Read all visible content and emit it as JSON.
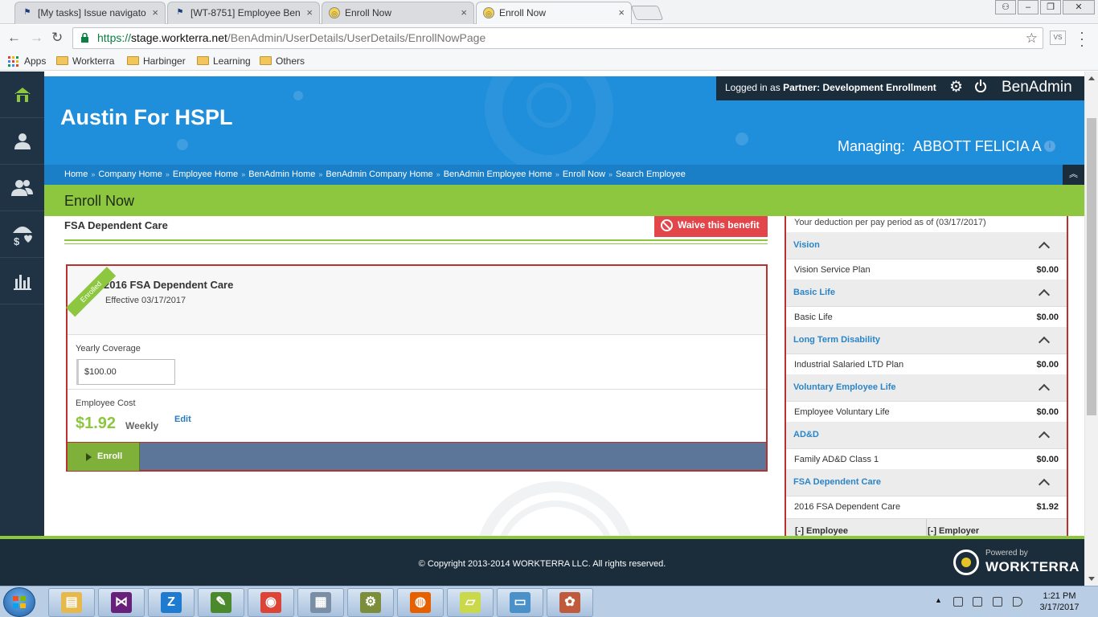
{
  "browser": {
    "tabs": [
      {
        "label": "[My tasks] Issue navigato",
        "active": false
      },
      {
        "label": "[WT-8751] Employee Ben",
        "active": false
      },
      {
        "label": "Enroll Now",
        "active": false
      },
      {
        "label": "Enroll Now",
        "active": true
      }
    ],
    "tab_close": "×",
    "url_scheme": "https://",
    "url_host": "stage.workterra.net",
    "url_path": "/BenAdmin/UserDetails/UserDetails/EnrollNowPage",
    "star": "☆",
    "ext_label": "VS",
    "back": "←",
    "forward": "→",
    "reload": "↻",
    "bookmarks": [
      {
        "label": "Apps",
        "icon": "apps-grid-icon"
      },
      {
        "label": "Workterra",
        "icon": "folder-icon"
      },
      {
        "label": "Harbinger",
        "icon": "folder-icon"
      },
      {
        "label": "Learning",
        "icon": "folder-icon"
      },
      {
        "label": "Others",
        "icon": "folder-icon"
      }
    ]
  },
  "header": {
    "logged_in_prefix": "Logged in as",
    "logged_in_role": "Partner:",
    "logged_in_name": "Development Enrollment",
    "brand": "BenAdmin",
    "company": "Austin For HSPL",
    "managing_label": "Managing:",
    "managing_name": "ABBOTT FELICIA A",
    "info_glyph": "i"
  },
  "breadcrumbs": [
    "Home",
    "Company Home",
    "Employee Home",
    "BenAdmin Home",
    "BenAdmin Company Home",
    "BenAdmin Employee Home",
    "Enroll Now",
    "Search Employee"
  ],
  "breadcrumb_sep": "»",
  "collapse_glyph": "︽",
  "page_title": "Enroll Now",
  "section": {
    "title": "FSA Dependent Care",
    "waive_label": "Waive this benefit"
  },
  "card": {
    "ribbon": "Enrolled",
    "plan_name": "2016 FSA Dependent Care",
    "effective": "Effective 03/17/2017",
    "coverage_label": "Yearly Coverage",
    "coverage_value": "$100.00",
    "cost_label": "Employee Cost",
    "cost_value": "$1.92",
    "cost_frequency": "Weekly",
    "edit_label": "Edit",
    "enroll_label": "Enroll"
  },
  "summary": {
    "as_of": "Your deduction per pay period as of (03/17/2017)",
    "groups": [
      {
        "name": "Vision",
        "item": "Vision Service Plan",
        "amount": "$0.00"
      },
      {
        "name": "Basic Life",
        "item": "Basic Life",
        "amount": "$0.00"
      },
      {
        "name": "Long Term Disability",
        "item": "Industrial Salaried LTD Plan",
        "amount": "$0.00"
      },
      {
        "name": "Voluntary Employee Life",
        "item": "Employee Voluntary Life",
        "amount": "$0.00"
      },
      {
        "name": "AD&D",
        "item": "Family AD&D Class 1",
        "amount": "$0.00"
      },
      {
        "name": "FSA Dependent Care",
        "item": "2016 FSA Dependent Care",
        "amount": "$1.92"
      }
    ],
    "footer_employee": "[-] Employee",
    "footer_employer": "[-] Employer"
  },
  "footer": {
    "copyright": "© Copyright 2013-2014 WORKTERRA LLC. All rights reserved.",
    "powered_by": "Powered by",
    "powered_brand": "WORKTERRA"
  },
  "taskbar": {
    "apps": [
      {
        "name": "file-explorer",
        "glyph": "▤",
        "color": "#e7b84a"
      },
      {
        "name": "visual-studio",
        "glyph": "⋈",
        "color": "#68217a"
      },
      {
        "name": "zoho",
        "glyph": "Z",
        "color": "#1f7bd0"
      },
      {
        "name": "project",
        "glyph": "✎",
        "color": "#4a8a2c"
      },
      {
        "name": "chrome",
        "glyph": "◉",
        "color": "#db4437"
      },
      {
        "name": "calculator",
        "glyph": "▦",
        "color": "#7a8ea5"
      },
      {
        "name": "tools",
        "glyph": "⚙",
        "color": "#7c8e3a"
      },
      {
        "name": "firefox",
        "glyph": "◍",
        "color": "#e66000"
      },
      {
        "name": "sticky-notes",
        "glyph": "▱",
        "color": "#c9d94a"
      },
      {
        "name": "notes",
        "glyph": "▭",
        "color": "#4a90c9"
      },
      {
        "name": "paint",
        "glyph": "✿",
        "color": "#c05a3c"
      }
    ],
    "time": "1:21 PM",
    "date": "3/17/2017",
    "tray_arrow": "▲"
  },
  "colors": {
    "brand_blue": "#1f8edb",
    "brand_green": "#8dc63f",
    "nav_dark": "#1f3344",
    "accent_red": "#b83232",
    "waive_red": "#e2454a"
  }
}
